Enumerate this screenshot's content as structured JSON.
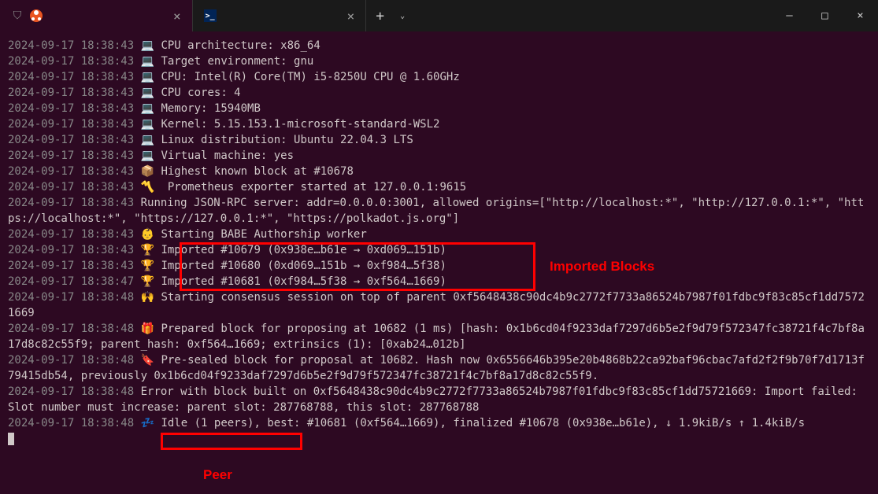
{
  "titlebar": {
    "tab1_close": "×",
    "tab2_close": "×",
    "newtab": "+",
    "chevron": "⌄",
    "min": "—",
    "max": "□",
    "close": "×"
  },
  "annotations": {
    "imported_blocks": "Imported Blocks",
    "peer": "Peer"
  },
  "log": [
    {
      "ts": "2024-09-17 18:38:43",
      "icon": "💻",
      "text": "CPU architecture: x86_64"
    },
    {
      "ts": "2024-09-17 18:38:43",
      "icon": "💻",
      "text": "Target environment: gnu"
    },
    {
      "ts": "2024-09-17 18:38:43",
      "icon": "💻",
      "text": "CPU: Intel(R) Core(TM) i5-8250U CPU @ 1.60GHz"
    },
    {
      "ts": "2024-09-17 18:38:43",
      "icon": "💻",
      "text": "CPU cores: 4"
    },
    {
      "ts": "2024-09-17 18:38:43",
      "icon": "💻",
      "text": "Memory: 15940MB"
    },
    {
      "ts": "2024-09-17 18:38:43",
      "icon": "💻",
      "text": "Kernel: 5.15.153.1-microsoft-standard-WSL2"
    },
    {
      "ts": "2024-09-17 18:38:43",
      "icon": "💻",
      "text": "Linux distribution: Ubuntu 22.04.3 LTS"
    },
    {
      "ts": "2024-09-17 18:38:43",
      "icon": "💻",
      "text": "Virtual machine: yes"
    },
    {
      "ts": "2024-09-17 18:38:43",
      "icon": "📦",
      "text": "Highest known block at #10678"
    },
    {
      "ts": "2024-09-17 18:38:43",
      "icon": "〽️",
      "text": " Prometheus exporter started at 127.0.0.1:9615"
    },
    {
      "ts": "2024-09-17 18:38:43",
      "icon": "",
      "text": "Running JSON-RPC server: addr=0.0.0.0:3001, allowed origins=[\"http://localhost:*\", \"http://127.0.0.1:*\", \"https://localhost:*\", \"https://127.0.0.1:*\", \"https://polkadot.js.org\"]"
    },
    {
      "ts": "2024-09-17 18:38:43",
      "icon": "👶",
      "text": "Starting BABE Authorship worker"
    },
    {
      "ts": "2024-09-17 18:38:43",
      "icon": "🏆",
      "text": "Imported #10679 (0x938e…b61e → 0xd069…151b)"
    },
    {
      "ts": "2024-09-17 18:38:43",
      "icon": "🏆",
      "text": "Imported #10680 (0xd069…151b → 0xf984…5f38)"
    },
    {
      "ts": "2024-09-17 18:38:47",
      "icon": "🏆",
      "text": "Imported #10681 (0xf984…5f38 → 0xf564…1669)"
    },
    {
      "ts": "2024-09-17 18:38:48",
      "icon": "🙌",
      "text": "Starting consensus session on top of parent 0xf5648438c90dc4b9c2772f7733a86524b7987f01fdbc9f83c85cf1dd75721669"
    },
    {
      "ts": "2024-09-17 18:38:48",
      "icon": "🎁",
      "text": "Prepared block for proposing at 10682 (1 ms) [hash: 0x1b6cd04f9233daf7297d6b5e2f9d79f572347fc38721f4c7bf8a17d8c82c55f9; parent_hash: 0xf564…1669; extrinsics (1): [0xab24…012b]"
    },
    {
      "ts": "2024-09-17 18:38:48",
      "icon": "🔖",
      "text": "Pre-sealed block for proposal at 10682. Hash now 0x6556646b395e20b4868b22ca92baf96cbac7afd2f2f9b70f7d1713f79415db54, previously 0x1b6cd04f9233daf7297d6b5e2f9d79f572347fc38721f4c7bf8a17d8c82c55f9."
    },
    {
      "ts": "2024-09-17 18:38:48",
      "icon": "",
      "text": "Error with block built on 0xf5648438c90dc4b9c2772f7733a86524b7987f01fdbc9f83c85cf1dd75721669: Import failed: Slot number must increase: parent slot: 287768788, this slot: 287768788"
    },
    {
      "ts": "2024-09-17 18:38:48",
      "icon": "💤",
      "text": "Idle (1 peers), best: #10681 (0xf564…1669), finalized #10678 (0x938e…b61e), ↓ 1.9kiB/s ↑ 1.4kiB/s"
    }
  ]
}
